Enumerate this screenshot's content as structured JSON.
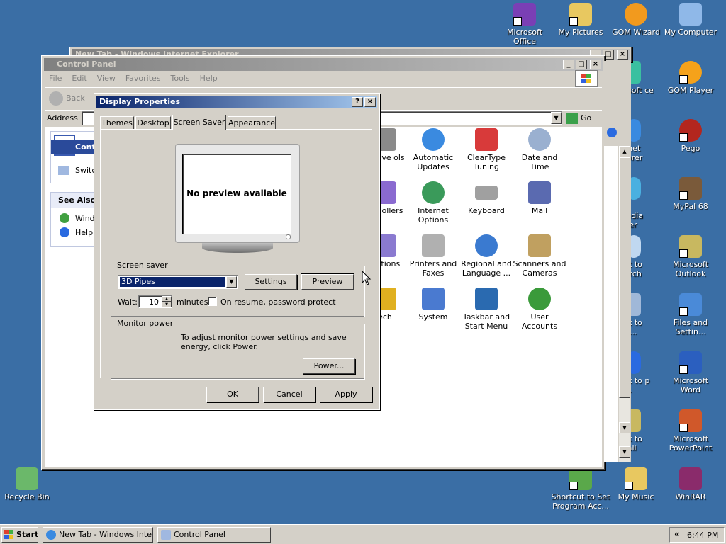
{
  "desktop": {
    "icons": [
      {
        "label": "Microsoft Office",
        "color": "#7a3fb5"
      },
      {
        "label": "My Pictures",
        "color": "#e8c860"
      },
      {
        "label": "GOM Wizard",
        "color": "#f29a1e"
      },
      {
        "label": "My Computer",
        "color": "#8fb8e8"
      },
      {
        "label": "GOM Player",
        "color": "#f5a21a"
      },
      {
        "label": "Pego",
        "color": "#b3261e"
      },
      {
        "label": "MyPal 68",
        "color": "#7a5a3a"
      },
      {
        "label": "Microsoft Outlook",
        "color": "#c8b860"
      },
      {
        "label": "Files and Settin...",
        "color": "#4a8ad8"
      },
      {
        "label": "Microsoft Word",
        "color": "#2b5fbf"
      },
      {
        "label": "Microsoft PowerPoint",
        "color": "#d0582a"
      },
      {
        "label": "Recycle Bin",
        "color": "#6bb86a"
      },
      {
        "label": "Shortcut to Set Program Acc...",
        "color": "#5aa84a"
      },
      {
        "label": "My Music",
        "color": "#e8c860"
      },
      {
        "label": "WinRAR",
        "color": "#8a2b6b"
      }
    ],
    "partial_labels": [
      "rosoft ce ...",
      "ernet plorer",
      "ws Media ayer",
      "cut to earch",
      "cut to un...",
      "cut to p a...",
      "cut to mail"
    ]
  },
  "ie_window": {
    "title": "New Tab - Windows Internet Explorer"
  },
  "control_panel": {
    "title": "Control Panel",
    "menu": [
      "File",
      "Edit",
      "View",
      "Favorites",
      "Tools",
      "Help"
    ],
    "back_label": "Back",
    "address_label": "Address",
    "go_label": "Go",
    "left_panel": {
      "header": "Control Panel",
      "switch_link": "Switch to Classic View",
      "see_also": "See Also",
      "links": [
        "Windows Update",
        "Help and Support"
      ]
    },
    "items": [
      {
        "label": "Administrative Tools",
        "color": "#8a8a8a"
      },
      {
        "label": "Automatic Updates",
        "color": "#3a8ae0"
      },
      {
        "label": "ClearType Tuning",
        "color": "#d83a3a"
      },
      {
        "label": "Date and Time",
        "color": "#9ab0d0"
      },
      {
        "label": "Game Controllers",
        "color": "#8a6ad0"
      },
      {
        "label": "Internet Options",
        "color": "#3a9a5a"
      },
      {
        "label": "Keyboard",
        "color": "#a0a0a0"
      },
      {
        "label": "Mail",
        "color": "#5a6ab0"
      },
      {
        "label": "Power Options",
        "color": "#8a7ad0"
      },
      {
        "label": "Printers and Faxes",
        "color": "#b0b0b0"
      },
      {
        "label": "Regional and Language ...",
        "color": "#3a7ad0"
      },
      {
        "label": "Scanners and Cameras",
        "color": "#c0a060"
      },
      {
        "label": "Speech",
        "color": "#e0b020"
      },
      {
        "label": "System",
        "color": "#4a7ad0"
      },
      {
        "label": "Taskbar and Start Menu",
        "color": "#2a6ab0"
      },
      {
        "label": "User Accounts",
        "color": "#3a9a3a"
      }
    ],
    "partial_labels": [
      "trative ols",
      "me ollers",
      "Options",
      "ech"
    ]
  },
  "display_properties": {
    "title": "Display Properties",
    "tabs": [
      "Themes",
      "Desktop",
      "Screen Saver",
      "Appearance"
    ],
    "active_tab": "Screen Saver",
    "preview_text": "No preview available",
    "screen_saver_label": "Screen saver",
    "screen_saver_value": "3D Pipes",
    "settings_label": "Settings",
    "preview_label": "Preview",
    "wait_label": "Wait:",
    "wait_value": "10",
    "minutes_label": "minutes",
    "password_label": "On resume, password protect",
    "monitor_power_label": "Monitor power",
    "monitor_power_text": "To adjust monitor power settings and save energy, click Power.",
    "power_label": "Power...",
    "ok_label": "OK",
    "cancel_label": "Cancel",
    "apply_label": "Apply"
  },
  "taskbar": {
    "start_label": "Start",
    "tasks": [
      "New Tab - Windows Inte...",
      "Control Panel"
    ],
    "clock": "6:44 PM",
    "tray_arrow": "«"
  }
}
